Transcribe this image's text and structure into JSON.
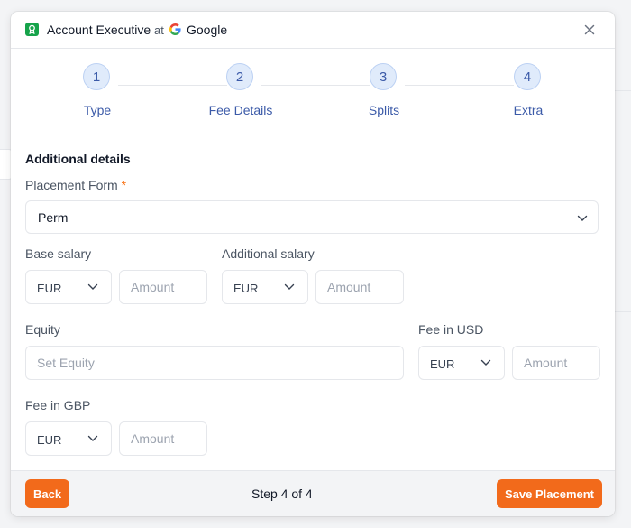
{
  "header": {
    "job_title": "Account Executive",
    "at": "at",
    "company": "Google",
    "icons": {
      "award": "award-icon",
      "company": "google-logo-icon",
      "close": "close-icon"
    }
  },
  "stepper": {
    "steps": [
      {
        "number": "1",
        "label": "Type"
      },
      {
        "number": "2",
        "label": "Fee Details"
      },
      {
        "number": "3",
        "label": "Splits"
      },
      {
        "number": "4",
        "label": "Extra"
      }
    ],
    "current": 4
  },
  "form": {
    "section_title": "Additional details",
    "placement_form": {
      "label": "Placement Form",
      "required": "*",
      "value": "Perm"
    },
    "base_salary": {
      "label": "Base salary",
      "currency": "EUR",
      "amount_placeholder": "Amount"
    },
    "additional_salary": {
      "label": "Additional salary",
      "currency": "EUR",
      "amount_placeholder": "Amount"
    },
    "equity": {
      "label": "Equity",
      "placeholder": "Set Equity"
    },
    "fee_usd": {
      "label": "Fee in USD",
      "currency": "EUR",
      "amount_placeholder": "Amount"
    },
    "fee_gbp": {
      "label": "Fee in GBP",
      "currency": "EUR",
      "amount_placeholder": "Amount"
    }
  },
  "footer": {
    "back_label": "Back",
    "step_text": "Step 4 of 4",
    "save_label": "Save Placement"
  },
  "colors": {
    "accent": "#f26a1b",
    "step_fill": "#e0ebfb",
    "step_text": "#3b5aa8"
  }
}
